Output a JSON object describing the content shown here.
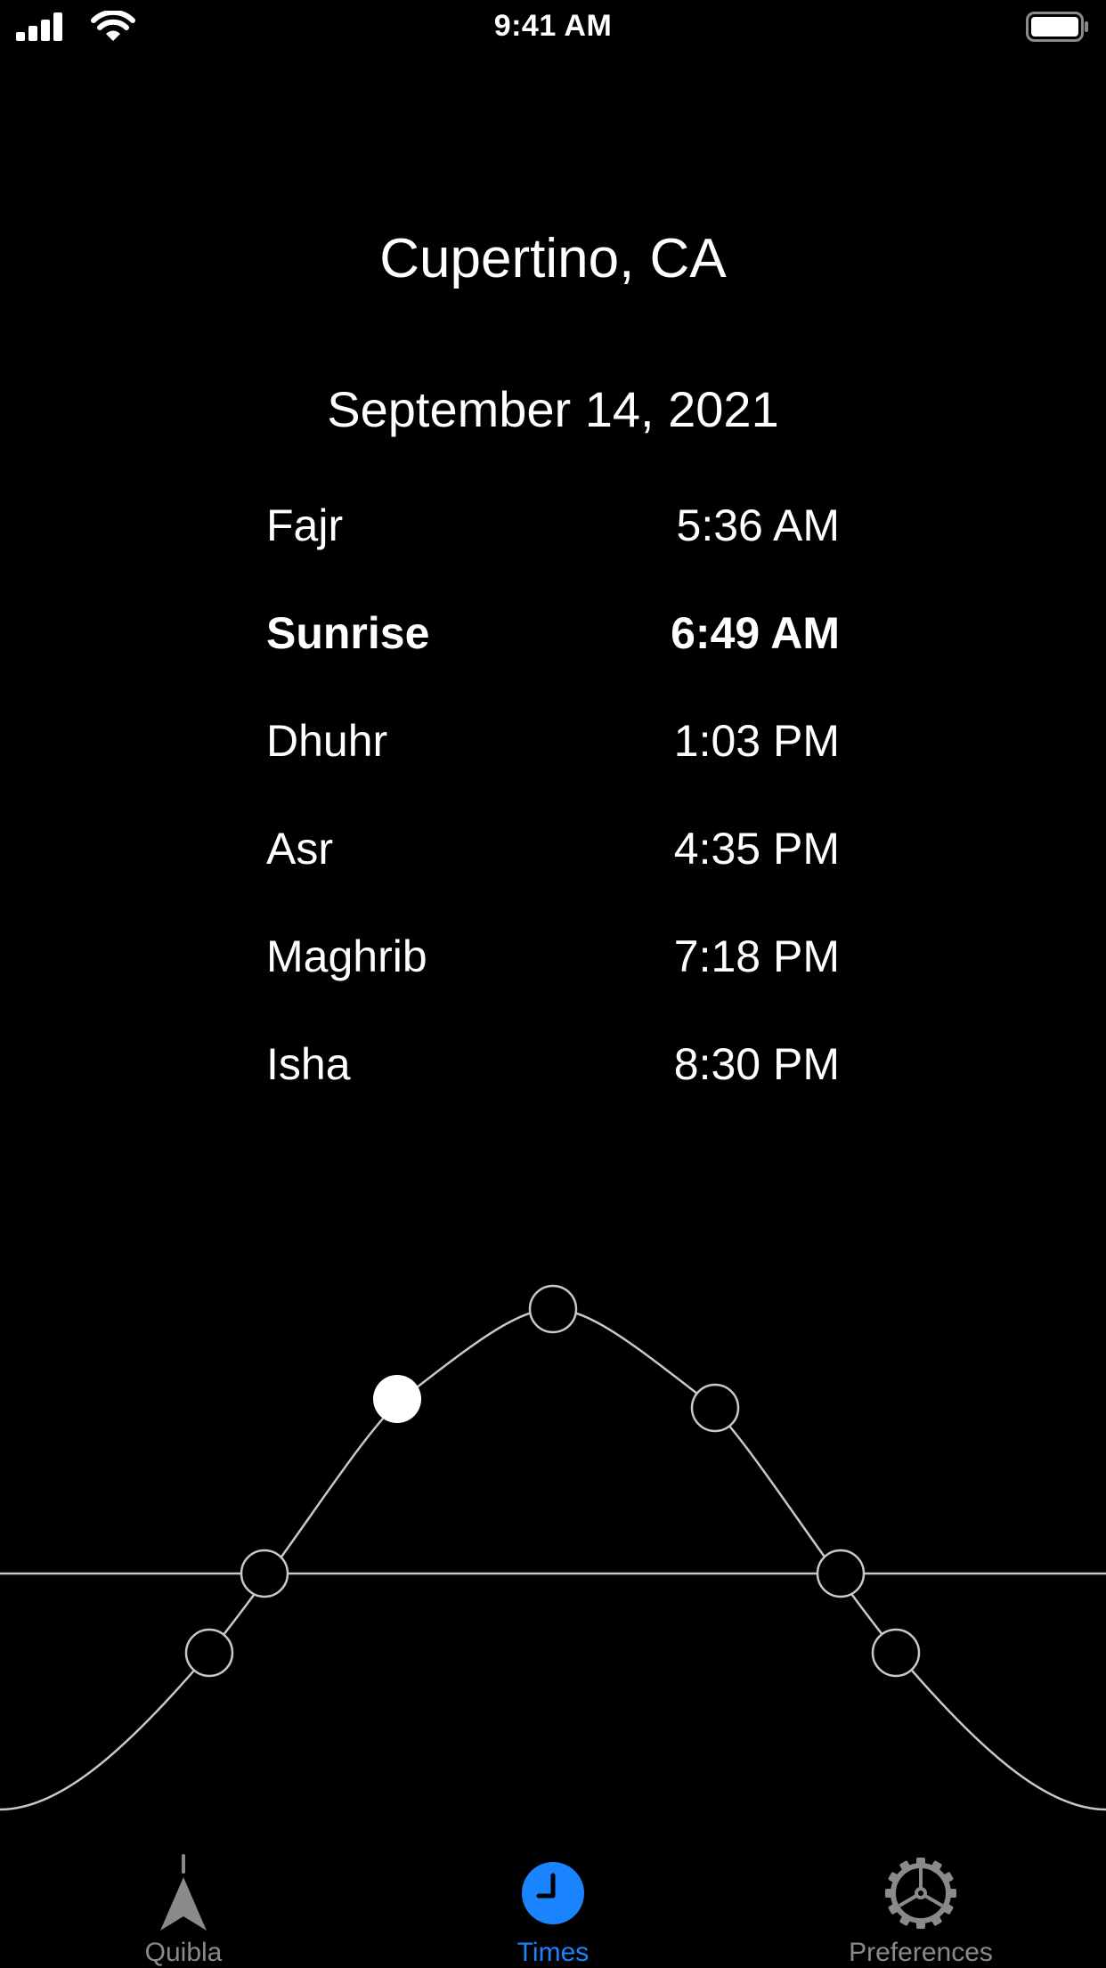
{
  "status_bar": {
    "time": "9:41 AM",
    "icons": [
      "cellular-signal-icon",
      "wifi-icon",
      "battery-icon"
    ]
  },
  "location": "Cupertino, CA",
  "date": "September 14, 2021",
  "prayer_times": [
    {
      "name": "Fajr",
      "time": "5:36 AM",
      "current": false
    },
    {
      "name": "Sunrise",
      "time": "6:49 AM",
      "current": true
    },
    {
      "name": "Dhuhr",
      "time": "1:03 PM",
      "current": false
    },
    {
      "name": "Asr",
      "time": "4:35 PM",
      "current": false
    },
    {
      "name": "Maghrib",
      "time": "7:18 PM",
      "current": false
    },
    {
      "name": "Isha",
      "time": "8:30 PM",
      "current": false
    }
  ],
  "sun_path": {
    "markers": [
      "Fajr",
      "Sunrise",
      "Current",
      "Dhuhr",
      "Asr",
      "Maghrib",
      "Isha"
    ],
    "current_marker": "Current"
  },
  "tabs": [
    {
      "label": "Quibla",
      "icon": "compass-arrow-icon",
      "active": false
    },
    {
      "label": "Times",
      "icon": "clock-icon",
      "active": true
    },
    {
      "label": "Preferences",
      "icon": "gear-icon",
      "active": false
    }
  ],
  "colors": {
    "background": "#000000",
    "text": "#ffffff",
    "accent": "#1a84ff",
    "inactive": "#8a8a8a",
    "curve": "#c8c8c8"
  }
}
